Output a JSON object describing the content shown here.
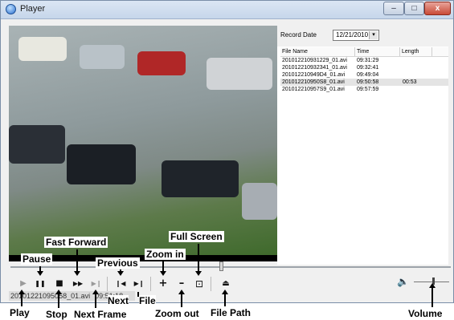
{
  "window": {
    "title": "Player",
    "min_label": "–",
    "max_label": "□",
    "close_label": "x"
  },
  "panel": {
    "record_date_label": "Record Date",
    "record_date_value": "12/21/2010",
    "dropdown_glyph": "▾",
    "columns": [
      "File Name",
      "Time",
      "Length"
    ],
    "files": [
      {
        "name": "201012210931229_01.avi",
        "time": "09:31:29",
        "length": ""
      },
      {
        "name": "201012210932341_01.avi",
        "time": "09:32:41",
        "length": ""
      },
      {
        "name": "201012210949D4_01.avi",
        "time": "09:49:04",
        "length": ""
      },
      {
        "name": "201012210950S8_01.avi",
        "time": "09:50:58",
        "length": "00:53"
      },
      {
        "name": "201012210957S9_01.avi",
        "time": "09:57:59",
        "length": ""
      }
    ]
  },
  "status": {
    "file": "20101221095058_01.avi",
    "time": "09:51:18"
  },
  "controls": {
    "play": "▶",
    "pause": "❚❚",
    "stop": "■",
    "fast_forward": "▶▶",
    "next_frame": "▶❙",
    "previous": "❙◀",
    "next_file": "▶❙",
    "zoom_in": "+",
    "zoom_out": "–",
    "full_screen": "⊡",
    "file_path": "⏏",
    "volume_icon": "🔈"
  },
  "annotations": {
    "pause": "Pause",
    "fast_forward": "Fast Forward",
    "full_screen": "Full Screen",
    "previous": "Previous",
    "zoom_in": "Zoom in",
    "next_file_a": "Next",
    "next_file_b": "File",
    "play": "Play",
    "stop": "Stop",
    "next_frame": "Next Frame",
    "zoom_out": "Zoom out",
    "file_path": "File Path",
    "volume": "Volume"
  },
  "colors": {
    "accent": "#2a6fcf",
    "close": "#c94a36"
  }
}
